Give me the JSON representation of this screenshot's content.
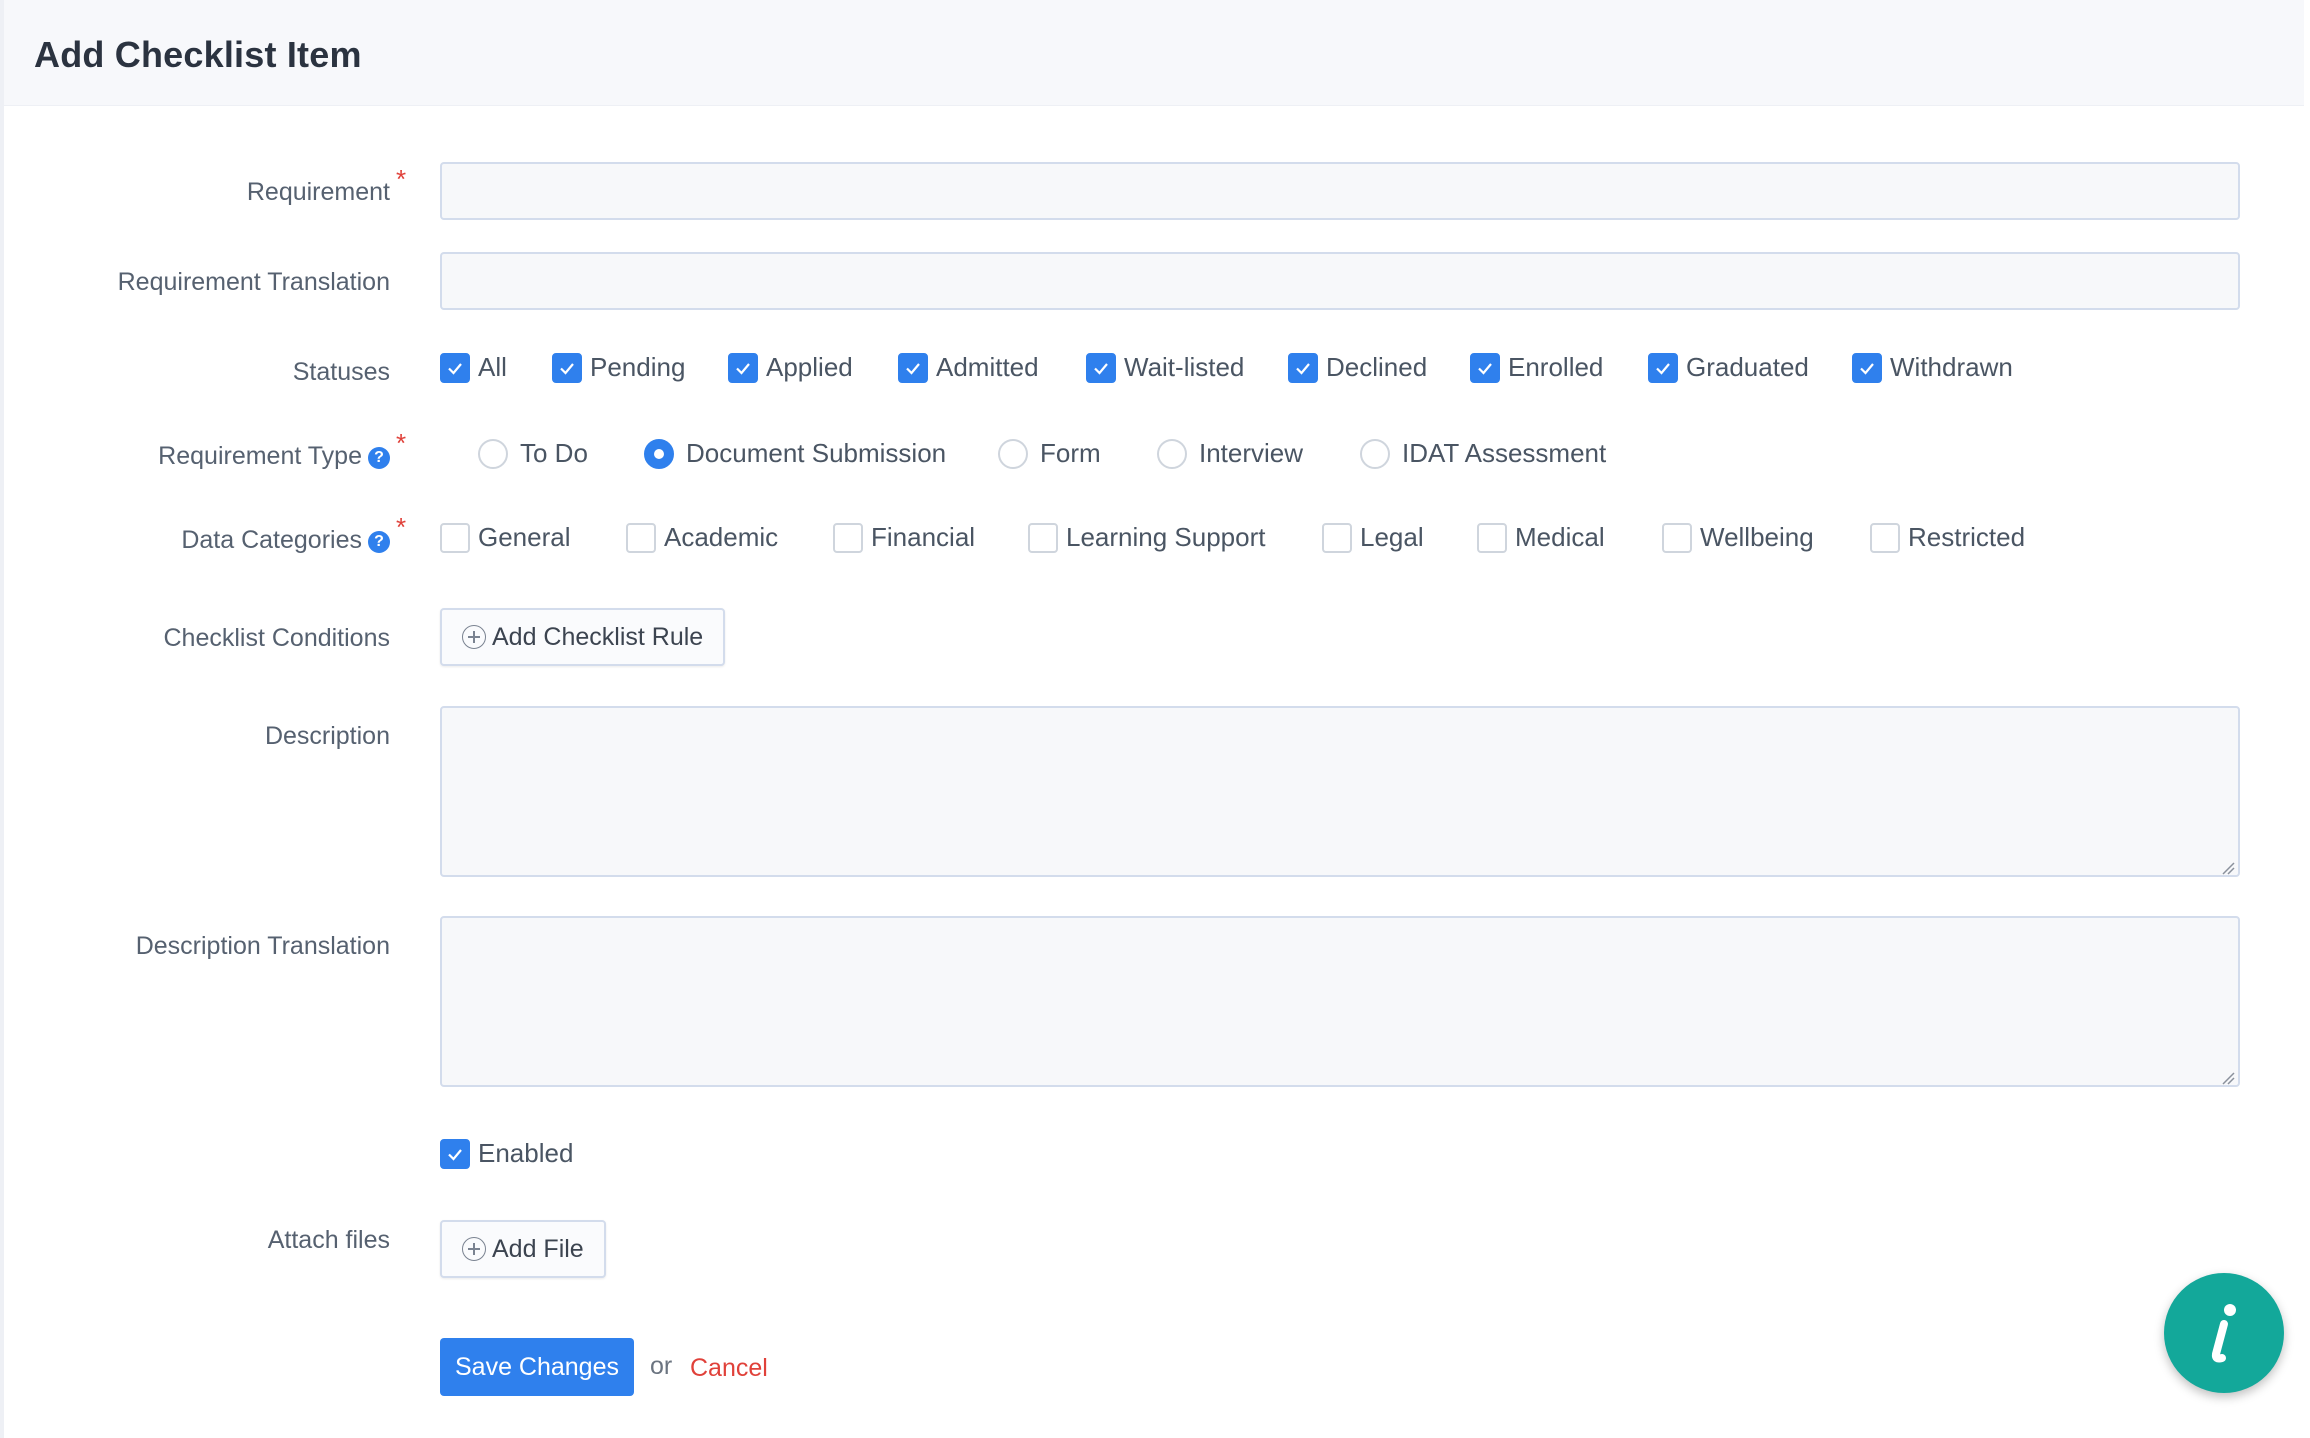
{
  "page": {
    "title": "Add Checklist Item"
  },
  "fields": {
    "requirement": {
      "label": "Requirement",
      "required": true,
      "value": ""
    },
    "requirement_translation": {
      "label": "Requirement Translation",
      "value": ""
    },
    "statuses": {
      "label": "Statuses",
      "options": [
        {
          "label": "All",
          "checked": true
        },
        {
          "label": "Pending",
          "checked": true
        },
        {
          "label": "Applied",
          "checked": true
        },
        {
          "label": "Admitted",
          "checked": true
        },
        {
          "label": "Wait-listed",
          "checked": true
        },
        {
          "label": "Declined",
          "checked": true
        },
        {
          "label": "Enrolled",
          "checked": true
        },
        {
          "label": "Graduated",
          "checked": true
        },
        {
          "label": "Withdrawn",
          "checked": true
        }
      ]
    },
    "requirement_type": {
      "label": "Requirement Type",
      "required": true,
      "help_icon": "question-circle-icon",
      "selected": "Document Submission",
      "options": [
        "To Do",
        "Document Submission",
        "Form",
        "Interview",
        "IDAT Assessment"
      ]
    },
    "data_categories": {
      "label": "Data Categories",
      "required": true,
      "help_icon": "question-circle-icon",
      "options": [
        {
          "label": "General",
          "checked": false
        },
        {
          "label": "Academic",
          "checked": false
        },
        {
          "label": "Financial",
          "checked": false
        },
        {
          "label": "Learning Support",
          "checked": false
        },
        {
          "label": "Legal",
          "checked": false
        },
        {
          "label": "Medical",
          "checked": false
        },
        {
          "label": "Wellbeing",
          "checked": false
        },
        {
          "label": "Restricted",
          "checked": false
        }
      ]
    },
    "checklist_conditions": {
      "label": "Checklist Conditions",
      "button_label": "Add Checklist Rule"
    },
    "description": {
      "label": "Description",
      "value": ""
    },
    "description_translation": {
      "label": "Description Translation",
      "value": ""
    },
    "enabled": {
      "label": "Enabled",
      "checked": true
    },
    "attach_files": {
      "label": "Attach files",
      "button_label": "Add File"
    }
  },
  "actions": {
    "save_label": "Save Changes",
    "or_text": "or",
    "cancel_label": "Cancel"
  },
  "help_fab": {
    "icon": "info-icon",
    "glyph": "i"
  },
  "colors": {
    "primary": "#2f80ed",
    "danger": "#e0413a",
    "fab": "#13a89a"
  }
}
